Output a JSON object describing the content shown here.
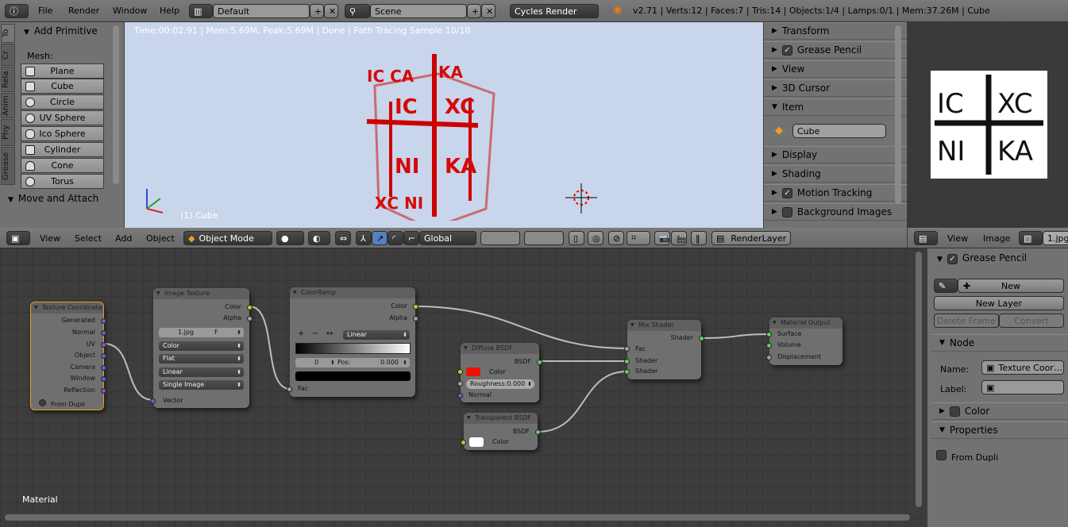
{
  "topbar": {
    "menus": [
      "File",
      "Render",
      "Window",
      "Help"
    ],
    "layout": "Default",
    "scene": "Scene",
    "engine": "Cycles Render",
    "stats": "v2.71 | Verts:12 | Faces:7 | Tris:14 | Objects:1/4 | Lamps:0/1 | Mem:37.26M | Cube"
  },
  "toolshelf": {
    "tabs": [
      "To",
      "Cr",
      "Rela",
      "Anim",
      "Phy",
      "Grease"
    ],
    "section": "Add Primitive",
    "mesh_label": "Mesh:",
    "items": [
      "Plane",
      "Cube",
      "Circle",
      "UV Sphere",
      "Ico Sphere",
      "Cylinder",
      "Cone",
      "Torus"
    ],
    "move_section": "Move and Attach"
  },
  "viewport": {
    "status": "Time:00:02.91 | Mem:5.69M, Peak:5.69M | Done | Path Tracing Sample 10/10",
    "object_label": "(1) Cube",
    "bg": "#c9d5ea"
  },
  "properties": {
    "sections": [
      "Transform",
      "Grease Pencil",
      "View",
      "3D Cursor",
      "Item",
      "Display",
      "Shading",
      "Motion Tracking",
      "Background Images"
    ],
    "item_name": "Cube"
  },
  "image_view": {
    "logo_text": [
      "IC",
      "XC",
      "NI",
      "KA"
    ]
  },
  "view3d_header": {
    "menus": [
      "View",
      "Select",
      "Add",
      "Object"
    ],
    "mode": "Object Mode",
    "orientation": "Global",
    "render_layer": "RenderLayer"
  },
  "image_header": {
    "menus": [
      "View",
      "Image"
    ],
    "image": "1.jpg"
  },
  "node_editor": {
    "label": "Material",
    "tex_coord": {
      "title": "Texture Coordinate",
      "outputs": [
        "Generated",
        "Normal",
        "UV",
        "Object",
        "Camera",
        "Window",
        "Reflection"
      ],
      "from_dupli": "From Dupli"
    },
    "image_tex": {
      "title": "Image Texture",
      "outputs": [
        "Color",
        "Alpha"
      ],
      "file": "1.jpg",
      "file_flag": "F",
      "options": [
        "Color",
        "Flat",
        "Linear",
        "Single Image"
      ],
      "input": "Vector"
    },
    "color_ramp": {
      "title": "ColorRamp",
      "outputs": [
        "Color",
        "Alpha"
      ],
      "interp": "Linear",
      "index": "0",
      "pos_label": "Pos:",
      "pos": "0.000",
      "input": "Fac"
    },
    "diffuse": {
      "title": "Diffuse BSDF",
      "output": "BSDF",
      "color_label": "Color",
      "color": "#ee1100",
      "roughness": "Roughness:0.000",
      "normal": "Normal"
    },
    "transparent": {
      "title": "Transparent BSDF",
      "output": "BSDF",
      "color_label": "Color",
      "color": "#ffffff"
    },
    "mix": {
      "title": "Mix Shader",
      "output": "Shader",
      "inputs": [
        "Fac",
        "Shader",
        "Shader"
      ]
    },
    "output": {
      "title": "Material Output",
      "inputs": [
        "Surface",
        "Volume",
        "Displacement"
      ]
    }
  },
  "npanel": {
    "grease_pencil": "Grease Pencil",
    "new": "New",
    "new_layer": "New Layer",
    "delete_frame": "Delete Frame",
    "convert": "Convert",
    "node": "Node",
    "name_label": "Name:",
    "name": "Texture Coor…",
    "label_label": "Label:",
    "label": "",
    "color": "Color",
    "properties": "Properties",
    "from_dupli": "From Dupli"
  }
}
